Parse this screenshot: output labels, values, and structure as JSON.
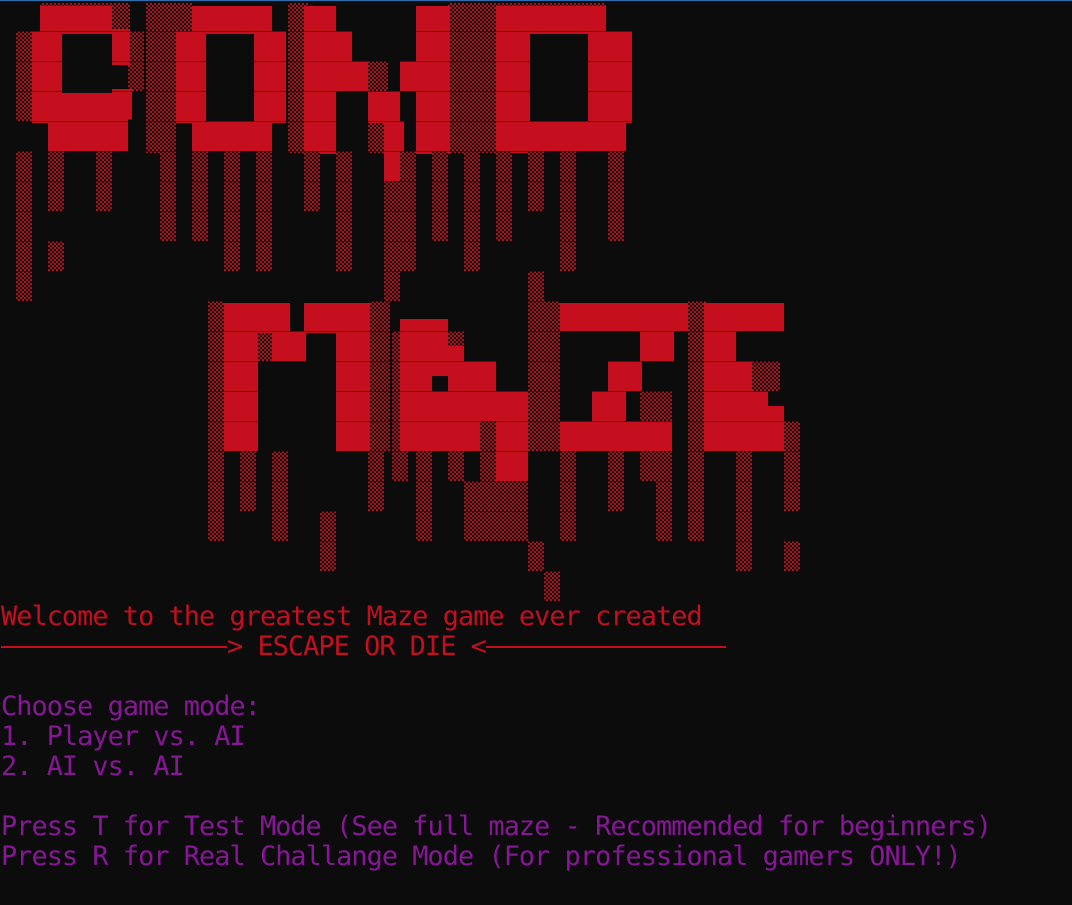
{
  "console": {
    "background": "#0c0c0c",
    "colors": {
      "banner_red": "#c50f1f",
      "banner_dark": "#7a0a14",
      "menu_purple": "#881798"
    }
  },
  "banner": {
    "logo_words": [
      "COMP",
      "MAZE"
    ]
  },
  "welcome": {
    "text": "Welcome to the greatest Maze game ever created",
    "tagline": "> ESCAPE OR DIE <"
  },
  "menu": {
    "heading": "Choose game mode:",
    "options": [
      "1. Player vs. AI",
      "2. AI vs. AI"
    ],
    "test_mode": "Press T for Test Mode (See full maze - Recommended for beginners)",
    "real_mode": "Press R for Real Challange Mode (For professional gamers ONLY!)"
  }
}
